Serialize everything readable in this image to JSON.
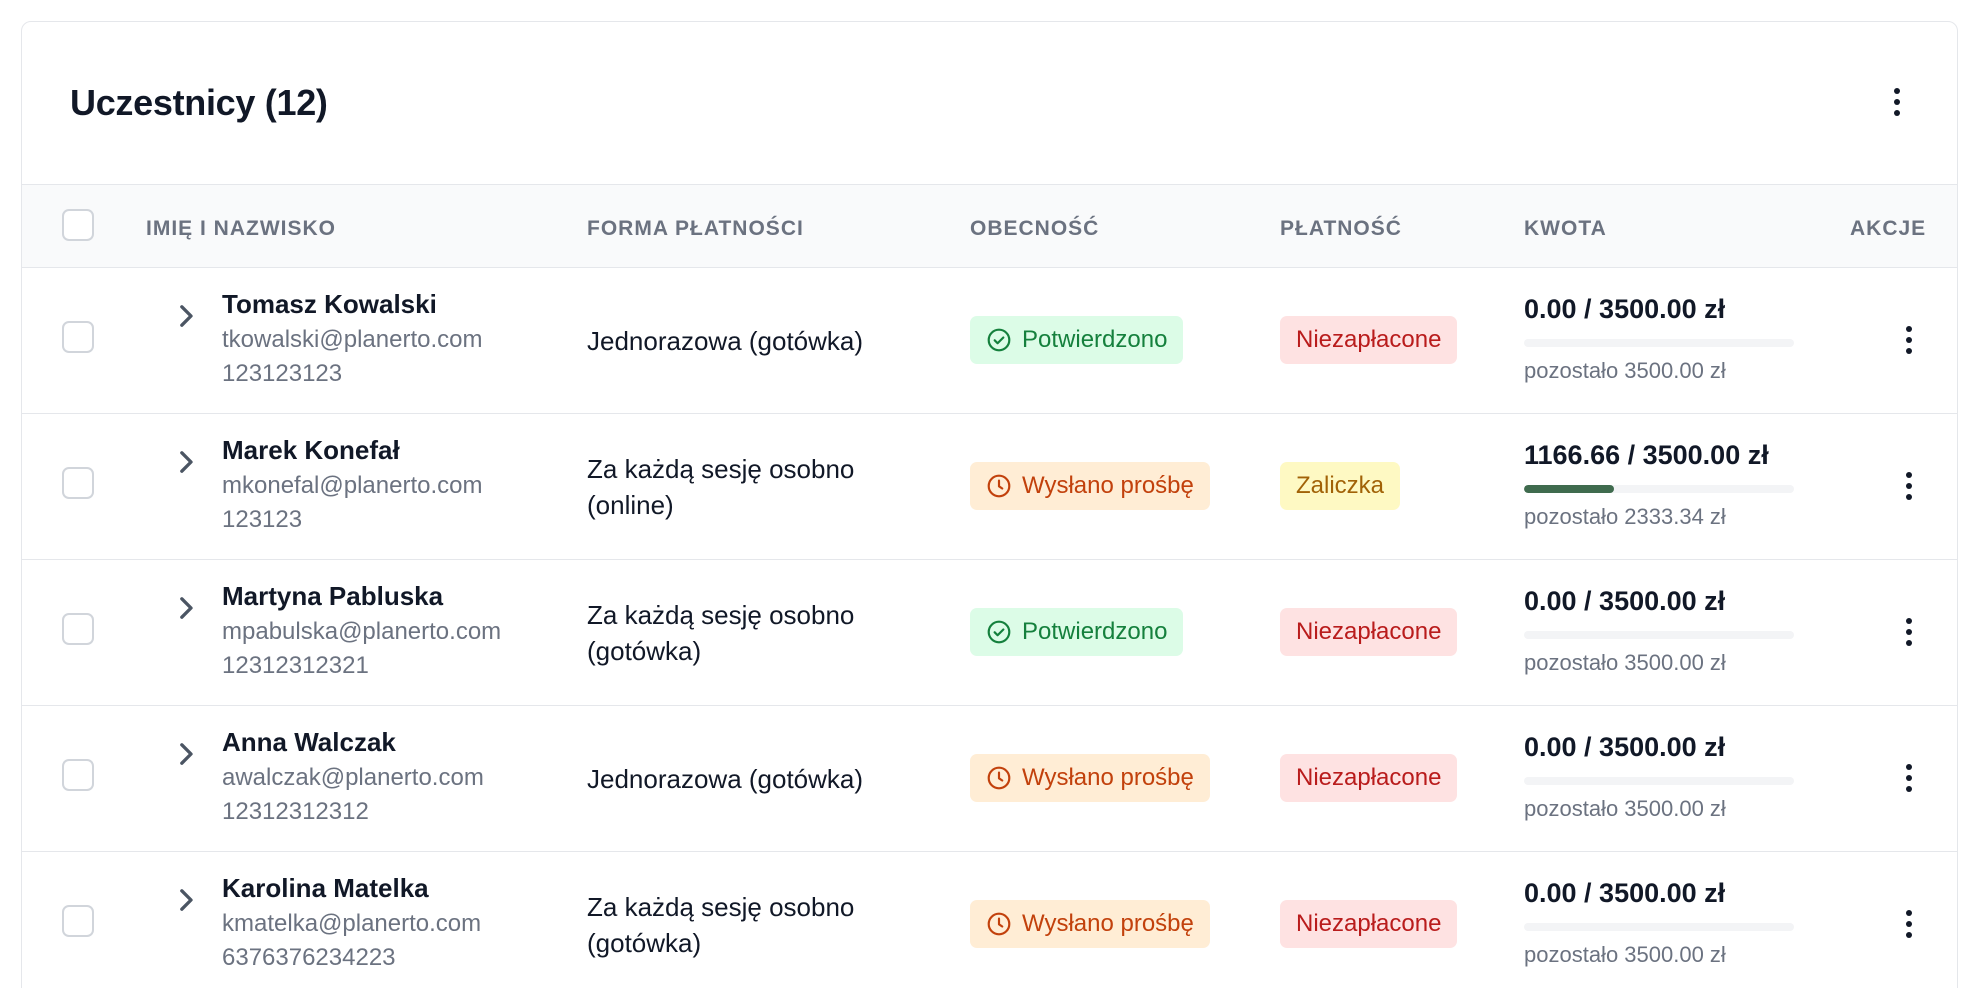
{
  "card": {
    "title": "Uczestnicy (12)",
    "menu_icon": "more-vertical-icon"
  },
  "table": {
    "headers": {
      "name": "IMIĘ I NAZWISKO",
      "payment_form": "FORMA PŁATNOŚCI",
      "attendance": "OBECNOŚĆ",
      "payment": "PŁATNOŚĆ",
      "amount": "KWOTA",
      "actions": "AKCJE"
    },
    "rows": [
      {
        "name": "Tomasz Kowalski",
        "email": "tkowalski@planerto.com",
        "phone": "123123123",
        "payment_form": "Jednorazowa (gotówka)",
        "attendance": "Potwierdzono",
        "attendance_status": "confirmed",
        "payment": "Niezapłacone",
        "payment_status": "unpaid",
        "amount": "0.00 / 3500.00 zł",
        "paid_fraction": 0,
        "remaining": "pozostało 3500.00 zł"
      },
      {
        "name": "Marek Konefał",
        "email": "mkonefal@planerto.com",
        "phone": "123123",
        "payment_form": "Za każdą sesję osobno (online)",
        "attendance": "Wysłano prośbę",
        "attendance_status": "request-sent",
        "payment": "Zaliczka",
        "payment_status": "deposit",
        "amount": "1166.66 / 3500.00 zł",
        "paid_fraction": 0.3333,
        "remaining": "pozostało 2333.34 zł"
      },
      {
        "name": "Martyna Pabluska",
        "email": "mpabulska@planerto.com",
        "phone": "12312312321",
        "payment_form": "Za każdą sesję osobno (gotówka)",
        "attendance": "Potwierdzono",
        "attendance_status": "confirmed",
        "payment": "Niezapłacone",
        "payment_status": "unpaid",
        "amount": "0.00 / 3500.00 zł",
        "paid_fraction": 0,
        "remaining": "pozostało 3500.00 zł"
      },
      {
        "name": "Anna Walczak",
        "email": "awalczak@planerto.com",
        "phone": "12312312312",
        "payment_form": "Jednorazowa (gotówka)",
        "attendance": "Wysłano prośbę",
        "attendance_status": "request-sent",
        "payment": "Niezapłacone",
        "payment_status": "unpaid",
        "amount": "0.00 / 3500.00 zł",
        "paid_fraction": 0,
        "remaining": "pozostało 3500.00 zł"
      },
      {
        "name": "Karolina Matelka",
        "email": "kmatelka@planerto.com",
        "phone": "6376376234223",
        "payment_form": "Za każdą sesję osobno (gotówka)",
        "attendance": "Wysłano prośbę",
        "attendance_status": "request-sent",
        "payment": "Niezapłacone",
        "payment_status": "unpaid",
        "amount": "0.00 / 3500.00 zł",
        "paid_fraction": 0,
        "remaining": "pozostało 3500.00 zł"
      }
    ]
  },
  "icons": {
    "confirmed": "check-circle-icon",
    "request_sent": "clock-icon",
    "expand": "chevron-right-icon",
    "row_menu": "more-vertical-icon"
  },
  "colors": {
    "confirmed_bg": "#dcfce7",
    "confirmed_text": "#15803d",
    "request_bg": "#ffedd5",
    "request_text": "#c2410c",
    "unpaid_bg": "#fee2e2",
    "unpaid_text": "#b91c1c",
    "deposit_bg": "#fef9c3",
    "deposit_text": "#a16207",
    "progress_fill": "#3f6b4e"
  }
}
